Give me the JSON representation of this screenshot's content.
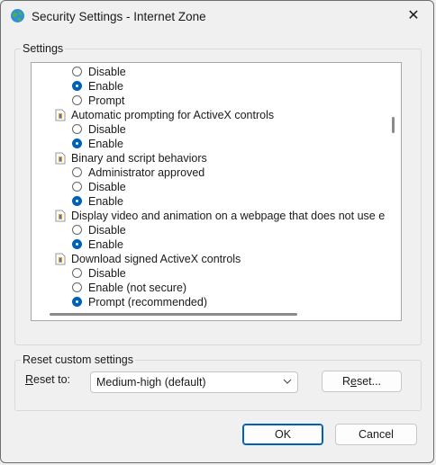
{
  "window": {
    "title": "Security Settings - Internet Zone",
    "close_glyph": "✕",
    "icon": "globe-shield-icon"
  },
  "settings_group": {
    "label": "Settings",
    "items": [
      {
        "kind": "option",
        "label": "Disable",
        "checked": false
      },
      {
        "kind": "option",
        "label": "Enable",
        "checked": true
      },
      {
        "kind": "option",
        "label": "Prompt",
        "checked": false
      },
      {
        "kind": "category",
        "label": "Automatic prompting for ActiveX controls"
      },
      {
        "kind": "option",
        "label": "Disable",
        "checked": false
      },
      {
        "kind": "option",
        "label": "Enable",
        "checked": true
      },
      {
        "kind": "category",
        "label": "Binary and script behaviors"
      },
      {
        "kind": "option",
        "label": "Administrator approved",
        "checked": false
      },
      {
        "kind": "option",
        "label": "Disable",
        "checked": false
      },
      {
        "kind": "option",
        "label": "Enable",
        "checked": true
      },
      {
        "kind": "category",
        "label": "Display video and animation on a webpage that does not use external media player"
      },
      {
        "kind": "option",
        "label": "Disable",
        "checked": false
      },
      {
        "kind": "option",
        "label": "Enable",
        "checked": true
      },
      {
        "kind": "category",
        "label": "Download signed ActiveX controls"
      },
      {
        "kind": "option",
        "label": "Disable",
        "checked": false
      },
      {
        "kind": "option",
        "label": "Enable (not secure)",
        "checked": false
      },
      {
        "kind": "option",
        "label": "Prompt (recommended)",
        "checked": true
      }
    ]
  },
  "reset_group": {
    "label": "Reset custom settings",
    "reset_to_label_prefix": "",
    "reset_to_label_key": "R",
    "reset_to_label_rest": "eset to:",
    "select_value": "Medium-high (default)",
    "reset_button_prefix": "R",
    "reset_button_key": "e",
    "reset_button_rest": "set..."
  },
  "footer": {
    "ok_label": "OK",
    "cancel_label": "Cancel"
  },
  "colors": {
    "accent": "#005fb8",
    "background": "#f0f0f0"
  }
}
